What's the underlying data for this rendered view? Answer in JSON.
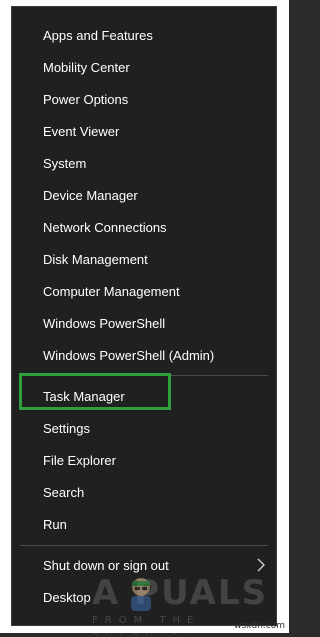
{
  "menu": {
    "group1": [
      {
        "label": "Apps and Features"
      },
      {
        "label": "Mobility Center"
      },
      {
        "label": "Power Options"
      },
      {
        "label": "Event Viewer"
      },
      {
        "label": "System"
      },
      {
        "label": "Device Manager"
      },
      {
        "label": "Network Connections"
      },
      {
        "label": "Disk Management"
      },
      {
        "label": "Computer Management"
      },
      {
        "label": "Windows PowerShell"
      },
      {
        "label": "Windows PowerShell (Admin)"
      }
    ],
    "group2": [
      {
        "label": "Task Manager"
      },
      {
        "label": "Settings"
      },
      {
        "label": "File Explorer"
      },
      {
        "label": "Search"
      },
      {
        "label": "Run"
      }
    ],
    "group3": [
      {
        "label": "Shut down or sign out"
      },
      {
        "label": "Desktop"
      }
    ]
  },
  "highlight_color": "#2fa13c",
  "watermark": {
    "brand": "A  PUALS",
    "tagline": "FROM THE EXPERTS!"
  },
  "credit": "wsxdn.com"
}
